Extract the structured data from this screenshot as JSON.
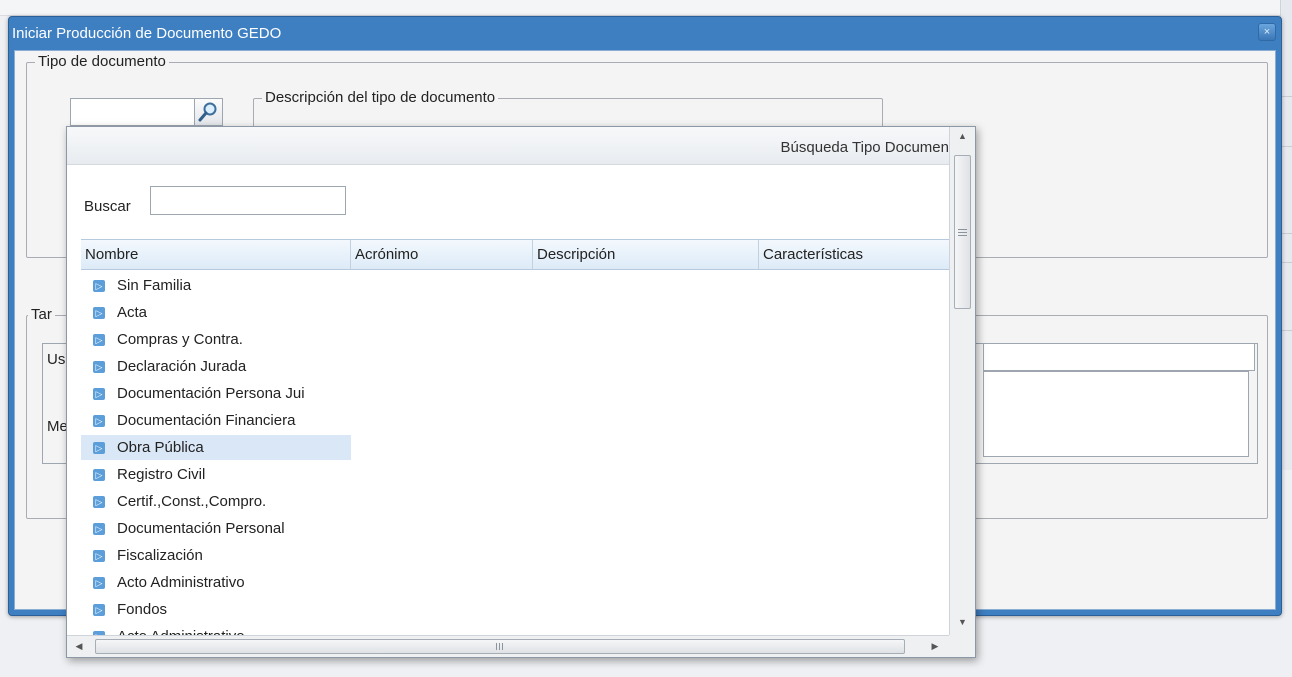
{
  "window": {
    "title": "Iniciar Producción de Documento GEDO",
    "close_label": "×"
  },
  "form": {
    "tipo_documento_legend": "Tipo de documento",
    "descripcion_legend": "Descripción del tipo de documento",
    "tarea_legend_fragment": "Tar",
    "usuario_label_fragment": "Us",
    "mensaje_label_fragment": "Me"
  },
  "popup": {
    "title": "Búsqueda Tipo Documen",
    "search_label": "Buscar",
    "search_value": "",
    "columns": [
      "Nombre",
      "Acrónimo",
      "Descripción",
      "Características"
    ],
    "rows": [
      {
        "label": "Sin Familia",
        "selected": false
      },
      {
        "label": "Acta",
        "selected": false
      },
      {
        "label": "Compras y Contra.",
        "selected": false
      },
      {
        "label": "Declaración Jurada",
        "selected": false
      },
      {
        "label": "Documentación Persona Jui",
        "selected": false
      },
      {
        "label": "Documentación Financiera",
        "selected": false
      },
      {
        "label": "Obra Pública",
        "selected": true
      },
      {
        "label": "Registro Civil",
        "selected": false
      },
      {
        "label": "Certif.,Const.,Compro.",
        "selected": false
      },
      {
        "label": "Documentación Personal",
        "selected": false
      },
      {
        "label": "Fiscalización",
        "selected": false
      },
      {
        "label": "Acto Administrativo",
        "selected": false
      },
      {
        "label": "Fondos",
        "selected": false
      },
      {
        "label": "Acto Administrativo",
        "selected": false
      }
    ],
    "row_icon": "folder-expand-icon",
    "row_icon_glyph": "▷",
    "vscroll": {
      "up": "▲",
      "down": "▼"
    },
    "hscroll": {
      "left": "◀",
      "right": "▶"
    }
  },
  "colors": {
    "titlebar": "#3e7fc2",
    "selection": "#dae7f6",
    "icon": "#5b9ed9"
  }
}
